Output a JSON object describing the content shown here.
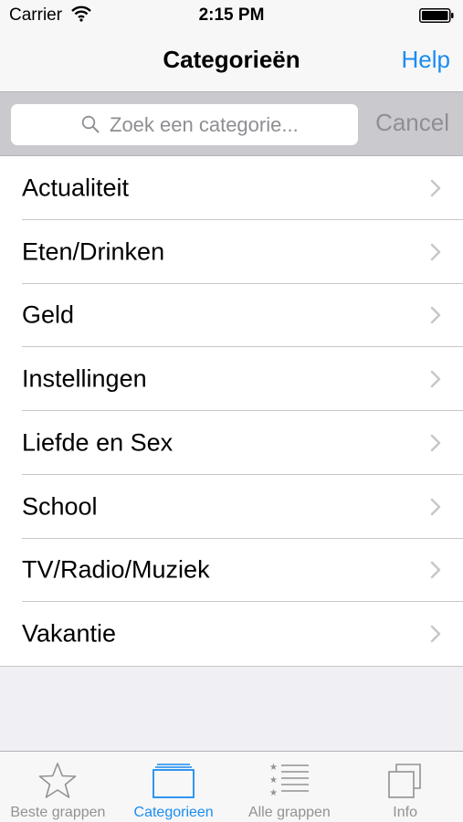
{
  "status_bar": {
    "carrier": "Carrier",
    "time": "2:15 PM"
  },
  "nav": {
    "title": "Categorieën",
    "help_label": "Help"
  },
  "search": {
    "placeholder": "Zoek een categorie...",
    "cancel_label": "Cancel"
  },
  "categories": [
    {
      "label": "Actualiteit"
    },
    {
      "label": "Eten/Drinken"
    },
    {
      "label": "Geld"
    },
    {
      "label": "Instellingen"
    },
    {
      "label": "Liefde en Sex"
    },
    {
      "label": "School"
    },
    {
      "label": "TV/Radio/Muziek"
    },
    {
      "label": "Vakantie"
    }
  ],
  "tabs": [
    {
      "label": "Beste grappen",
      "icon": "star-icon",
      "active": false
    },
    {
      "label": "Categorieen",
      "icon": "folder-icon",
      "active": true
    },
    {
      "label": "Alle grappen",
      "icon": "star-list-icon",
      "active": false
    },
    {
      "label": "Info",
      "icon": "copy-icon",
      "active": false
    }
  ],
  "colors": {
    "accent": "#1a8cf0",
    "inactive": "#929292"
  }
}
